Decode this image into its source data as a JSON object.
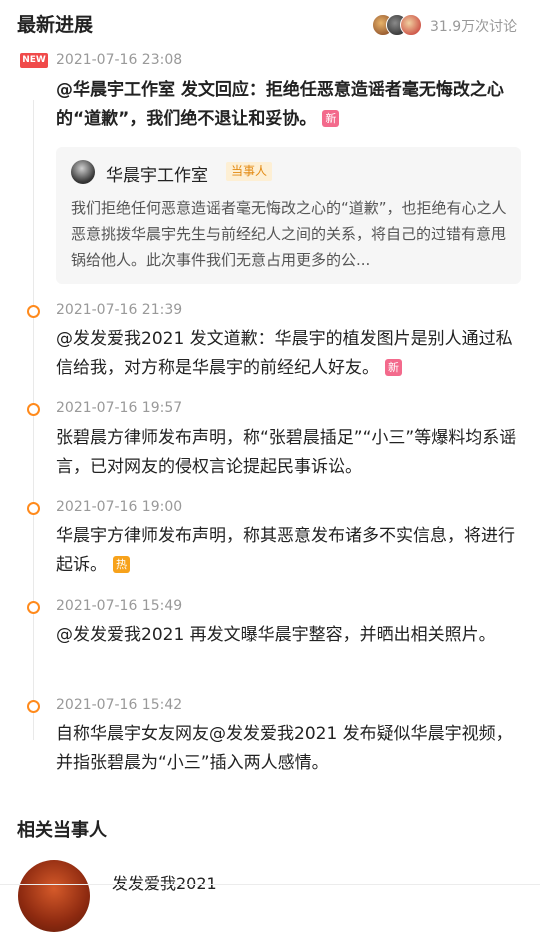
{
  "header": {
    "title": "最新进展",
    "discussion_count": "31.9万次讨论"
  },
  "timeline": [
    {
      "new_tag": "NEW",
      "time": "2021-07-16 23:08",
      "text": "@华晨宇工作室 发文回应：拒绝任恶意造谣者毫无悔改之心的“道歉”，我们绝不退让和妥协。",
      "badge": "新",
      "quote": {
        "author": "华晨宇工作室",
        "tag": "当事人",
        "text": "我们拒绝任何恶意造谣者毫无悔改之心的“道歉”，也拒绝有心之人恶意挑拨华晨宇先生与前经纪人之间的关系，将自己的过错有意甩锅给他人。此次事件我们无意占用更多的公..."
      }
    },
    {
      "time": "2021-07-16 21:39",
      "text": "@发发爱我2021 发文道歉：华晨宇的植发图片是别人通过私信给我，对方称是华晨宇的前经纪人好友。",
      "badge": "新"
    },
    {
      "time": "2021-07-16 19:57",
      "text": "张碧晨方律师发布声明，称“张碧晨插足”“小三”等爆料均系谣言，已对网友的侵权言论提起民事诉讼。"
    },
    {
      "time": "2021-07-16 19:00",
      "text": "华晨宇方律师发布声明，称其恶意发布诸多不实信息，将进行起诉。",
      "badge": "热"
    },
    {
      "time": "2021-07-16 15:49",
      "text": "@发发爱我2021 再发文曝华晨宇整容，并晒出相关照片。"
    },
    {
      "time": "2021-07-16 15:42",
      "text": "自称华晨宇女友网友@发发爱我2021 发布疑似华晨宇视频，并指张碧晨为“小三”插入两人感情。"
    }
  ],
  "related": {
    "title": "相关当事人",
    "person_name": "发发爱我2021"
  },
  "colors": {
    "accent_orange": "#ff8a1c",
    "new_red": "#f04a4a",
    "badge_new_pink": "#f36a8c",
    "badge_hot_orange": "#f7a21b",
    "muted_text": "#999999"
  }
}
